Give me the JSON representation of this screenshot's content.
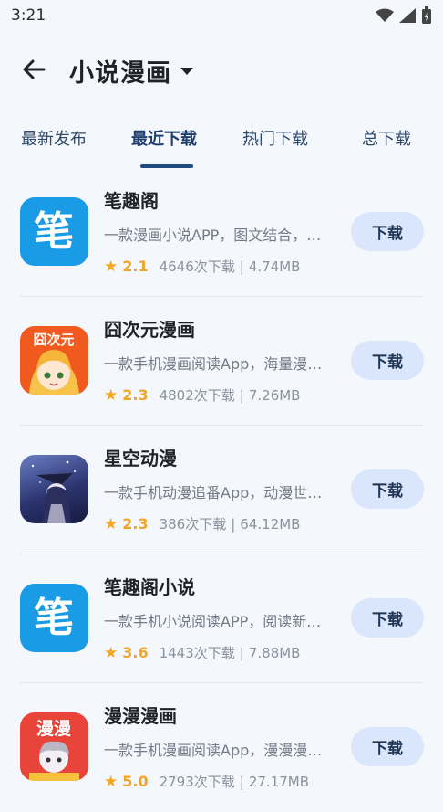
{
  "status_bar": {
    "time": "3:21"
  },
  "header": {
    "title": "小说漫画"
  },
  "tabs": [
    {
      "label": "最新发布",
      "active": false
    },
    {
      "label": "最近下载",
      "active": true
    },
    {
      "label": "热门下载",
      "active": false
    },
    {
      "label": "总下载",
      "active": false
    }
  ],
  "apps": [
    {
      "name": "笔趣阁",
      "desc": "一款漫画小说APP，图文结合，…",
      "rating": "2.1",
      "downloads": "4646次下载",
      "separator": "|",
      "size": "4.74MB",
      "button": "下载",
      "icon": "biquge-icon",
      "icon_color": "#1a9be6"
    },
    {
      "name": "囧次元漫画",
      "desc": "一款手机漫画阅读App，海量漫…",
      "rating": "2.3",
      "downloads": "4802次下载",
      "separator": "|",
      "size": "7.26MB",
      "button": "下载",
      "icon": "jiongciyuan-icon",
      "icon_color": "#f05a1e",
      "icon_text": "囧次元"
    },
    {
      "name": "星空动漫",
      "desc": "一款手机动漫追番App，动漫世…",
      "rating": "2.3",
      "downloads": "386次下载",
      "separator": "|",
      "size": "64.12MB",
      "button": "下载",
      "icon": "xingkong-icon",
      "icon_color": "#3a4a8a"
    },
    {
      "name": "笔趣阁小说",
      "desc": "一款手机小说阅读APP，阅读新…",
      "rating": "3.6",
      "downloads": "1443次下载",
      "separator": "|",
      "size": "7.88MB",
      "button": "下载",
      "icon": "biquge-novel-icon",
      "icon_color": "#1a9be6"
    },
    {
      "name": "漫漫漫画",
      "desc": "一款手机漫画阅读App，漫漫漫…",
      "rating": "5.0",
      "downloads": "2793次下载",
      "separator": "|",
      "size": "27.17MB",
      "button": "下载",
      "icon": "manman-icon",
      "icon_color": "#e8443a",
      "icon_text": "漫漫"
    }
  ]
}
